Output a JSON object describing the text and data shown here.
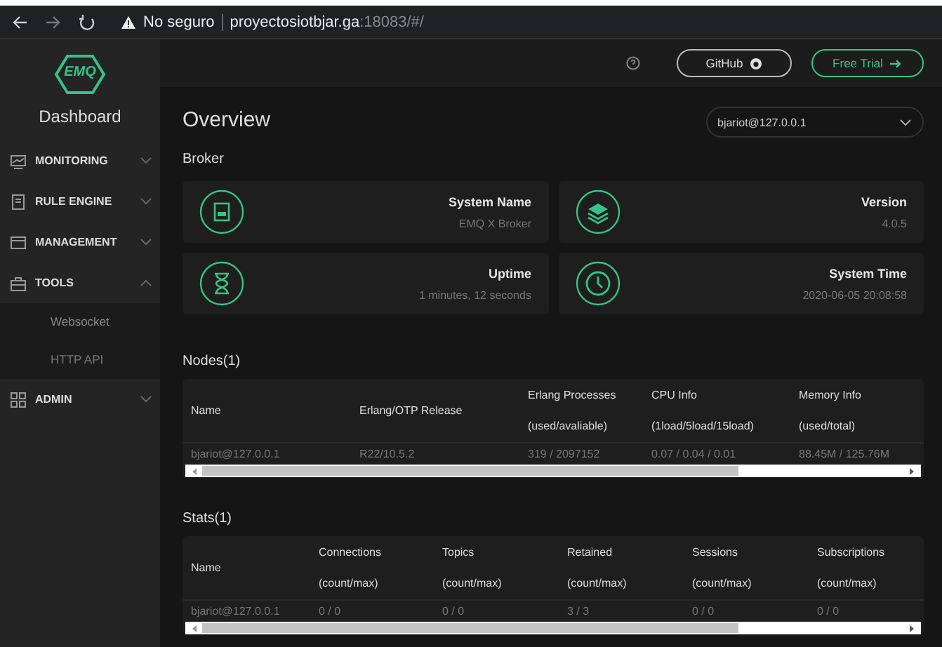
{
  "browser": {
    "security": "No seguro",
    "host": "proyectosiotbjar.ga",
    "path": ":18083/#/"
  },
  "header": {
    "buttons": [
      "GitHub",
      "Free Trial"
    ]
  },
  "sidebar": {
    "logo": "EMQ",
    "title": "Dashboard",
    "items": [
      {
        "label": "MONITORING",
        "expanded": false
      },
      {
        "label": "RULE ENGINE",
        "expanded": false
      },
      {
        "label": "MANAGEMENT",
        "expanded": false
      },
      {
        "label": "TOOLS",
        "expanded": true,
        "children": [
          {
            "label": "Websocket"
          },
          {
            "label": "HTTP API"
          }
        ]
      },
      {
        "label": "ADMIN",
        "expanded": false
      }
    ]
  },
  "overview": {
    "title": "Overview",
    "node_select": "bjariot@127.0.0.1",
    "section": "Broker",
    "cards": [
      {
        "label": "System Name",
        "value": "EMQ X Broker"
      },
      {
        "label": "Version",
        "value": "4.0.5"
      },
      {
        "label": "Uptime",
        "value": "1 minutes, 12 seconds"
      },
      {
        "label": "System Time",
        "value": "2020-06-05 20:08:58"
      }
    ]
  },
  "nodes": {
    "title": "Nodes(1)",
    "columns": [
      {
        "title": "Name"
      },
      {
        "title": "Erlang/OTP Release"
      },
      {
        "title": "Erlang Processes",
        "subtitle": "(used/avaliable)"
      },
      {
        "title": "CPU Info",
        "subtitle": "(1load/5load/15load)"
      },
      {
        "title": "Memory Info",
        "subtitle": "(used/total)"
      }
    ],
    "rows": [
      [
        "bjariot@127.0.0.1",
        "R22/10.5.2",
        "319 / 2097152",
        "0.07 / 0.04 / 0.01",
        "88.45M / 125.76M"
      ]
    ]
  },
  "stats": {
    "title": "Stats(1)",
    "columns": [
      {
        "title": "Name"
      },
      {
        "title": "Connections",
        "subtitle": "(count/max)"
      },
      {
        "title": "Topics",
        "subtitle": "(count/max)"
      },
      {
        "title": "Retained",
        "subtitle": "(count/max)"
      },
      {
        "title": "Sessions",
        "subtitle": "(count/max)"
      },
      {
        "title": "Subscriptions",
        "subtitle": "(count/max)"
      }
    ],
    "rows": [
      [
        "bjariot@127.0.0.1",
        "0 / 0",
        "0 / 0",
        "3 / 3",
        "0 / 0",
        "0 / 0"
      ]
    ]
  }
}
